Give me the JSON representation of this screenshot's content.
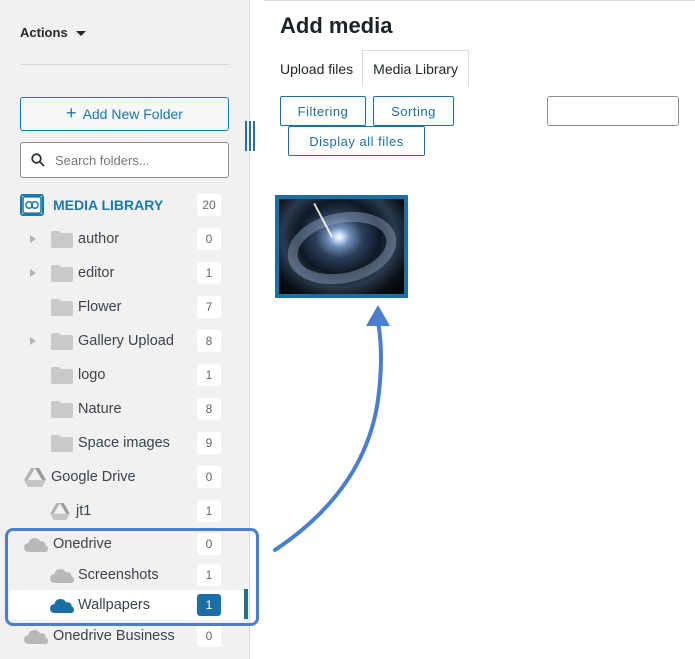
{
  "sidebar": {
    "actions_label": "Actions",
    "add_folder_label": "Add New Folder",
    "search_placeholder": "Search folders...",
    "media_library": {
      "label": "MEDIA LIBRARY",
      "count": "20"
    },
    "folders": [
      {
        "label": "author",
        "count": "0",
        "expandable": true
      },
      {
        "label": "editor",
        "count": "1",
        "expandable": true
      },
      {
        "label": "Flower",
        "count": "7",
        "expandable": false
      },
      {
        "label": "Gallery Upload",
        "count": "8",
        "expandable": true
      },
      {
        "label": "logo",
        "count": "1",
        "expandable": false
      },
      {
        "label": "Nature",
        "count": "8",
        "expandable": false
      },
      {
        "label": "Space images",
        "count": "9",
        "expandable": false
      }
    ],
    "cloud": [
      {
        "label": "Google Drive",
        "count": "0",
        "icon": "google-drive-icon"
      },
      {
        "label": "jt1",
        "count": "1",
        "icon": "google-drive-icon"
      },
      {
        "label": "Onedrive",
        "count": "0",
        "icon": "cloud-icon"
      },
      {
        "label": "Screenshots",
        "count": "1",
        "icon": "cloud-icon"
      },
      {
        "label": "Wallpapers",
        "count": "1",
        "icon": "cloud-icon",
        "active": true
      },
      {
        "label": "Onedrive Business",
        "count": "0",
        "icon": "cloud-icon"
      }
    ]
  },
  "main": {
    "title": "Add media",
    "tabs": [
      "Upload files",
      "Media Library"
    ],
    "active_tab": "Media Library",
    "buttons": {
      "filtering": "Filtering",
      "sorting": "Sorting",
      "display_all": "Display all files"
    }
  },
  "colors": {
    "accent": "#1a6fa3",
    "highlight": "#4a7fcf"
  }
}
